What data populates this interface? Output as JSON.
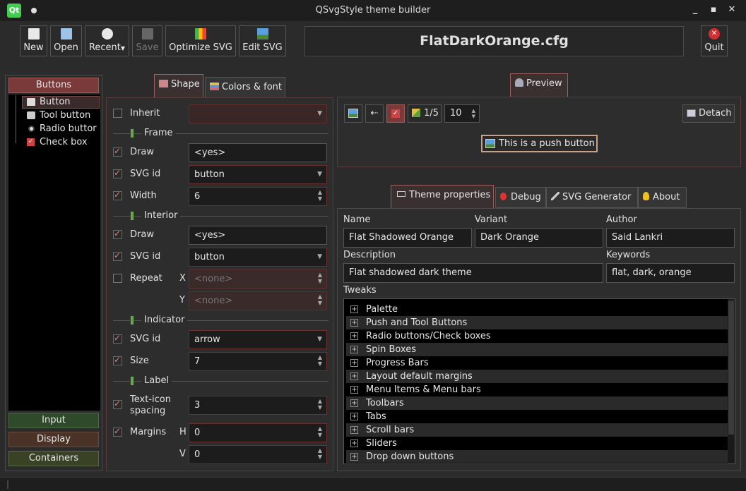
{
  "window": {
    "title": "QSvgStyle theme builder"
  },
  "toolbar": {
    "new": "New",
    "open": "Open",
    "recent": "Recent",
    "save": "Save",
    "optimize": "Optimize SVG",
    "edit": "Edit SVG",
    "quit": "Quit",
    "filename": "FlatDarkOrange.cfg"
  },
  "left_panel": {
    "group_buttons": "Buttons",
    "tree": [
      "Button",
      "Tool button",
      "Radio buttor",
      "Check box"
    ],
    "group_input": "Input",
    "group_display": "Display",
    "group_containers": "Containers"
  },
  "shape_tabs": {
    "shape": "Shape",
    "colors": "Colors & font"
  },
  "shape": {
    "inherit": "Inherit",
    "frame": "Frame",
    "interior": "Interior",
    "indicator": "Indicator",
    "label": "Label",
    "draw": "Draw",
    "svg_id": "SVG id",
    "width": "Width",
    "repeat": "Repeat",
    "x": "X",
    "y": "Y",
    "size": "Size",
    "text_icon_spacing_1": "Text-icon",
    "text_icon_spacing_2": "spacing",
    "margins": "Margins",
    "h": "H",
    "v": "V",
    "frame_draw_value": "<yes>",
    "frame_svg_value": "button",
    "frame_width_value": "6",
    "interior_draw_value": "<yes>",
    "interior_svg_value": "button",
    "repeat_x_value": "<none>",
    "repeat_y_value": "<none>",
    "indicator_svg_value": "arrow",
    "indicator_size_value": "7",
    "spacing_value": "3",
    "margin_h_value": "0",
    "margin_v_value": "0"
  },
  "preview": {
    "tab": "Preview",
    "page": "1/5",
    "spin_value": "10",
    "detach": "Detach",
    "push_button": "This is a push button"
  },
  "props_tabs": {
    "theme": "Theme properties",
    "debug": "Debug",
    "svggen": "SVG Generator",
    "about": "About"
  },
  "props": {
    "name_label": "Name",
    "variant_label": "Variant",
    "author_label": "Author",
    "name_value": "Flat Shadowed Orange",
    "variant_value": "Dark Orange",
    "author_value": "Said Lankri",
    "description_label": "Description",
    "keywords_label": "Keywords",
    "description_value": "Flat shadowed dark theme",
    "keywords_value": "flat, dark, orange",
    "tweaks_label": "Tweaks",
    "tweaks": [
      "Palette",
      "Push and Tool Buttons",
      "Radio buttons/Check boxes",
      "Spin Boxes",
      "Progress Bars",
      "Layout default margins",
      "Menu Items & Menu bars",
      "Toolbars",
      "Tabs",
      "Scroll bars",
      "Sliders",
      "Drop down buttons"
    ]
  }
}
